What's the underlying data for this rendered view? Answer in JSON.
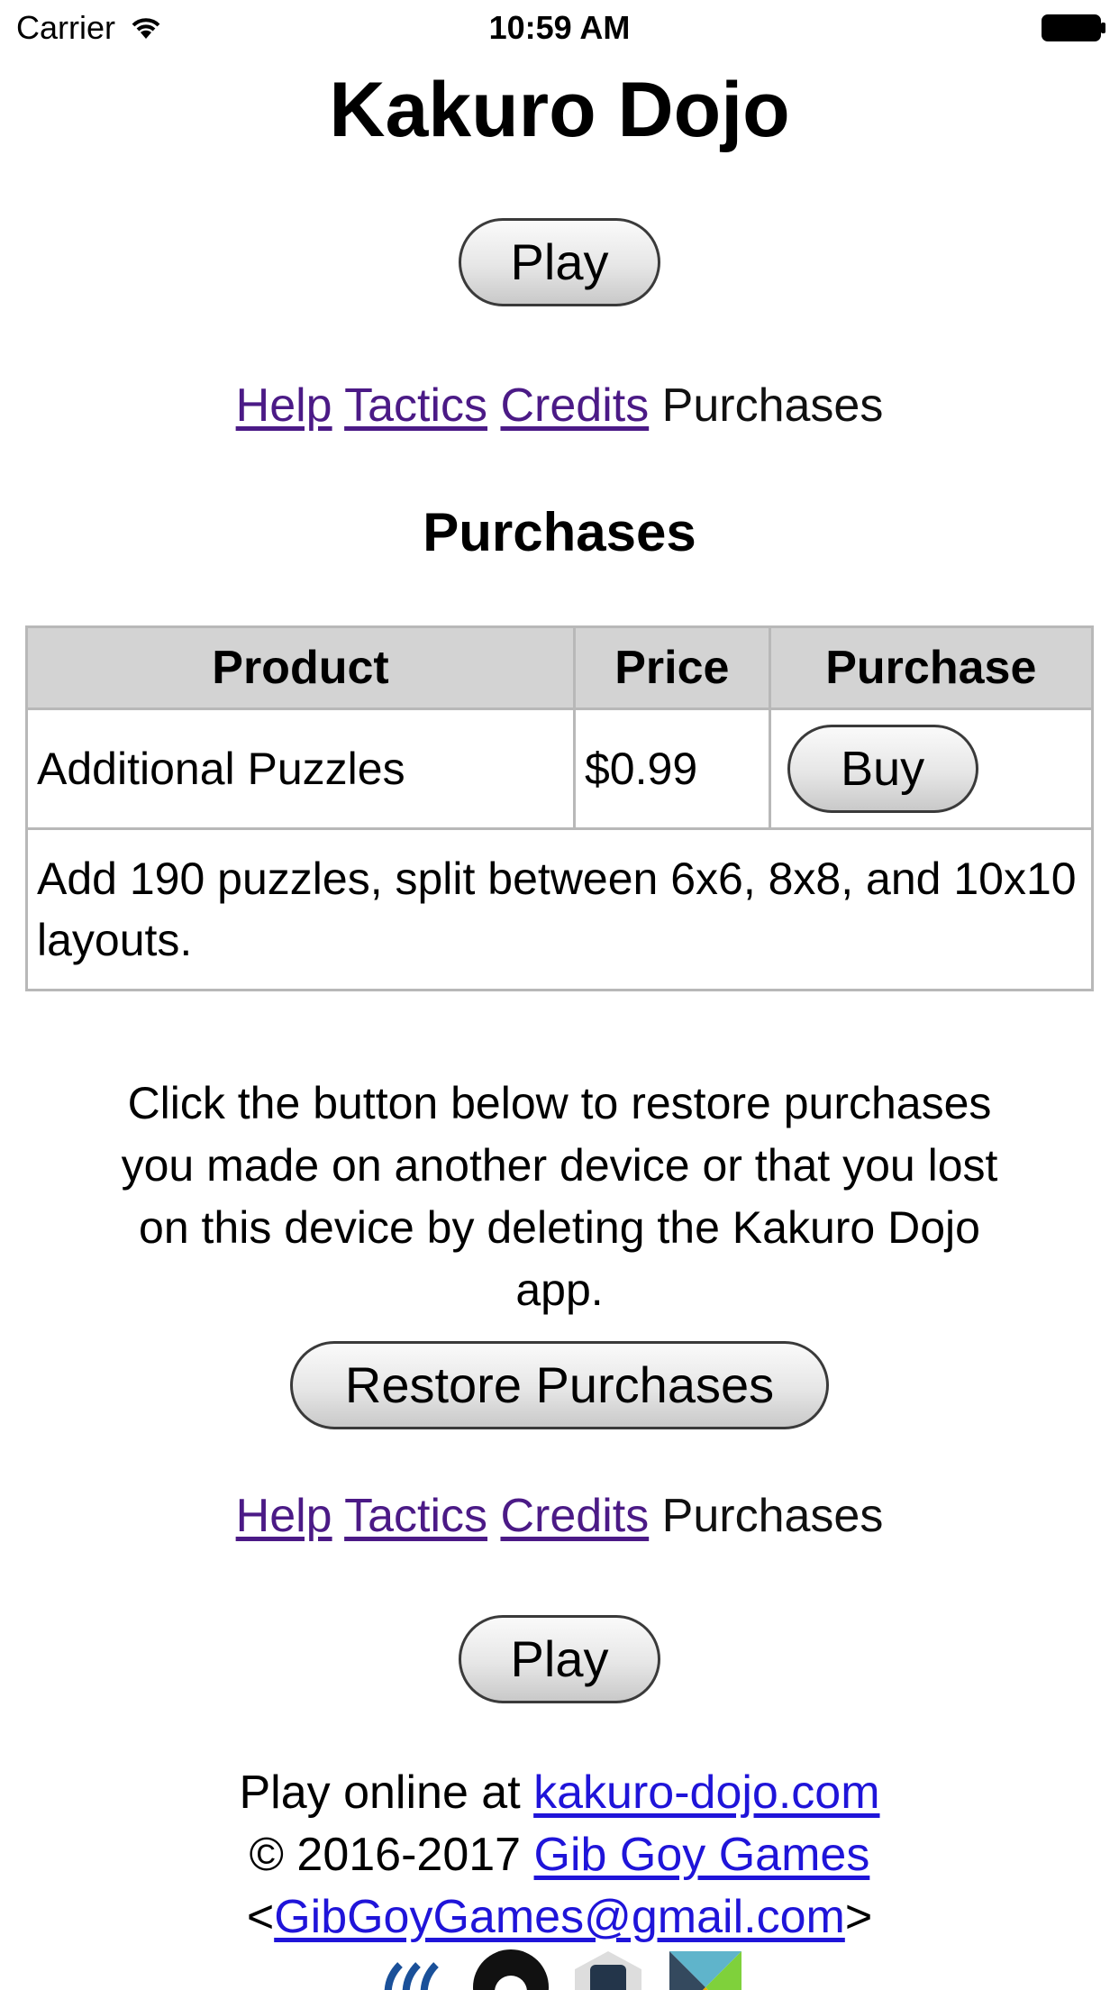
{
  "status_bar": {
    "carrier": "Carrier",
    "time": "10:59 AM",
    "icons": [
      "wifi-icon",
      "battery-icon"
    ]
  },
  "page": {
    "title": "Kakuro Dojo",
    "play_label": "Play"
  },
  "nav": {
    "items": [
      {
        "label": "Help",
        "link": true
      },
      {
        "label": "Tactics",
        "link": true
      },
      {
        "label": "Credits",
        "link": true
      },
      {
        "label": "Purchases",
        "link": false
      }
    ],
    "link_color": "#4b1a86"
  },
  "purchases": {
    "title": "Purchases",
    "table": {
      "headers": [
        "Product",
        "Price",
        "Purchase"
      ],
      "rows": [
        {
          "product": "Additional Puzzles",
          "price": "$0.99",
          "button": "Buy",
          "description": "Add 190 puzzles, split between 6x6, 8x8, and 10x10 layouts."
        }
      ]
    },
    "restore_text": "Click the button below to restore purchases you made on another device or that you lost on this device by deleting the Kakuro Dojo app.",
    "restore_button": "Restore Purchases"
  },
  "footer": {
    "play_online_prefix": "Play online at ",
    "site_link": "kakuro-dojo.com",
    "copyright_prefix": "© 2016-2017 ",
    "company_link": "Gib Goy Games",
    "email_open": "<",
    "email_link": "GibGoyGames@gmail.com",
    "email_close": ">",
    "link_color": "#1f14d9",
    "social_icons": [
      "steemit-icon",
      "github-icon",
      "octocat-robot-icon",
      "elm-icon"
    ]
  }
}
